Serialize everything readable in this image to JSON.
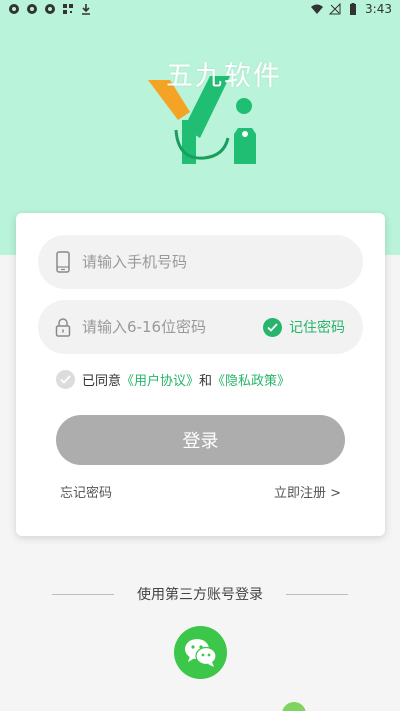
{
  "status_bar": {
    "time": "3:43",
    "left_icons": [
      "sync-icon",
      "sync-icon",
      "sync-icon",
      "qr-icon",
      "download-icon"
    ],
    "right_icons": [
      "wifi-icon",
      "signal-icon",
      "battery-icon"
    ]
  },
  "brand": {
    "watermark": "五九软件",
    "accent": "#26b56a",
    "logo_green": "#1fbe73",
    "logo_orange": "#f5a325",
    "top_bg": "#b9f3d9"
  },
  "login_form": {
    "phone": {
      "placeholder": "请输入手机号码",
      "value": "",
      "icon": "phone-icon"
    },
    "password": {
      "placeholder": "请输入6-16位密码",
      "value": "",
      "icon": "lock-icon"
    },
    "remember_label": "记住密码",
    "agree": {
      "prefix": "已同意",
      "user_agreement": "《用户协议》",
      "and": "和",
      "privacy_policy": "《隐私政策》"
    },
    "login_button": "登录",
    "forgot_password": "忘记密码",
    "register": "立即注册 >"
  },
  "third_party": {
    "label": "使用第三方账号登录",
    "wechat_icon": "wechat-icon",
    "wechat_color": "#3cc64a"
  }
}
